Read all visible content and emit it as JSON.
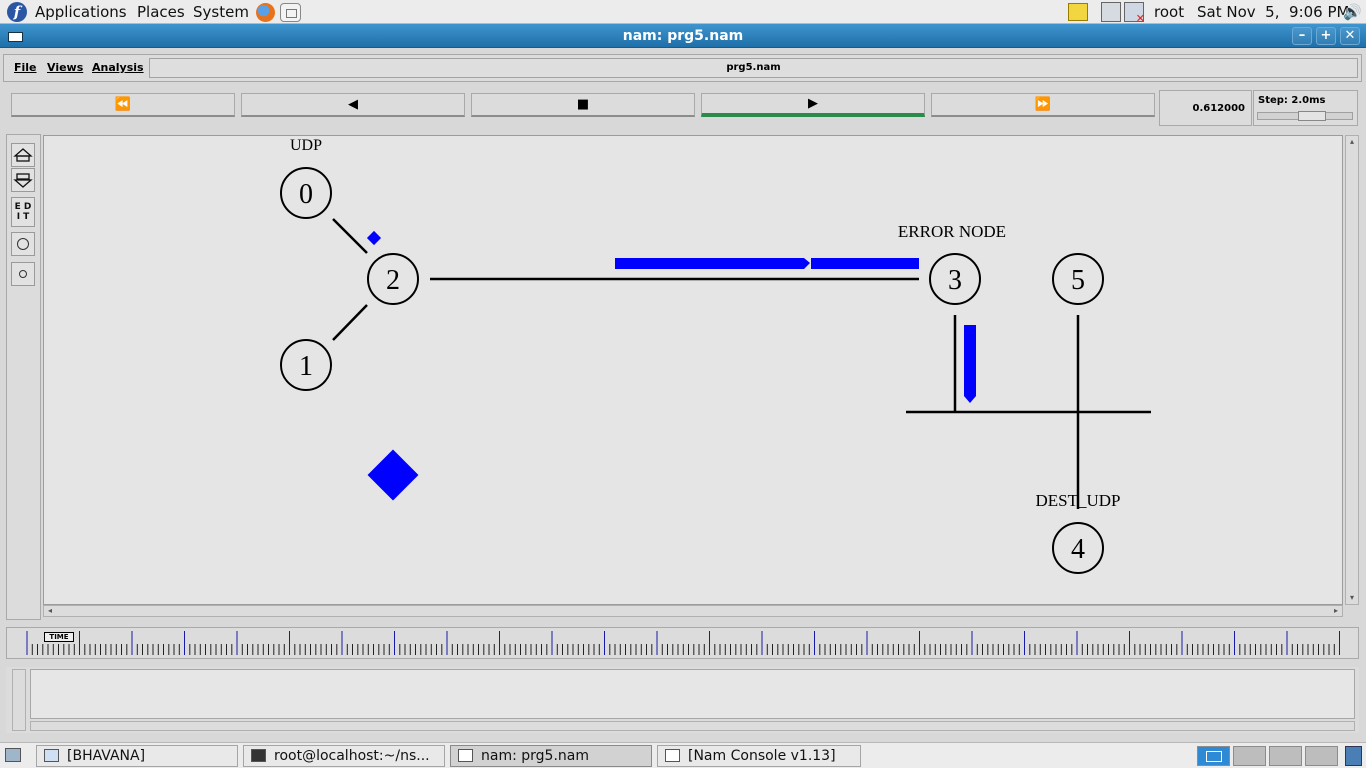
{
  "top_panel": {
    "menus": [
      "Applications",
      "Places",
      "System"
    ],
    "user": "root",
    "clock": "Sat Nov  5,  9:06 PM"
  },
  "window": {
    "title": "nam: prg5.nam",
    "controls": {
      "minimize": "–",
      "maximize": "+",
      "close": "✕"
    }
  },
  "menubar": {
    "items": [
      "File",
      "Views",
      "Analysis"
    ],
    "filename": "prg5.nam"
  },
  "transport": {
    "rewind": "⏪",
    "back": "◀",
    "stop": "■",
    "play": "▶",
    "fast_forward": "⏩",
    "time": "0.612000",
    "step_label": "Step: 2.0ms"
  },
  "left_tools": {
    "edit_label": "E D I T"
  },
  "network": {
    "labels": {
      "udp": "UDP",
      "error_node": "ERROR NODE",
      "dest_udp": "DEST_UDP"
    },
    "nodes": [
      {
        "id": "0"
      },
      {
        "id": "1"
      },
      {
        "id": "2"
      },
      {
        "id": "3"
      },
      {
        "id": "4"
      },
      {
        "id": "5"
      }
    ],
    "packet_color": "#0000ff"
  },
  "timeline": {
    "label": "TIME"
  },
  "taskbar": {
    "tasks": [
      {
        "label": "[BHAVANA]",
        "active": false
      },
      {
        "label": "root@localhost:~/ns...",
        "active": false
      },
      {
        "label": "nam: prg5.nam",
        "active": true
      },
      {
        "label": "[Nam Console v1.13]",
        "active": false
      }
    ]
  }
}
